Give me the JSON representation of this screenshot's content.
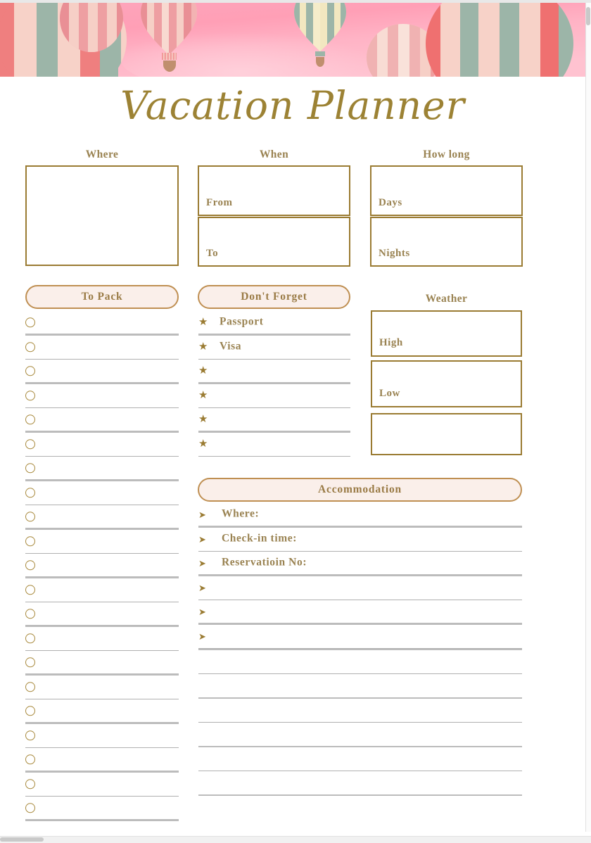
{
  "document": {
    "title": "Vacation Planner"
  },
  "colors": {
    "gold": "#9a7b32",
    "gold_text": "#9a8352",
    "title_gold": "#9c8234",
    "pill_fill": "#faefea",
    "pill_border": "#bf8f52",
    "rule": "#b4b4b4",
    "banner_pink": "#ffb4c6",
    "balloon_coral": "#f07e7e",
    "balloon_sage": "#9cb5a8",
    "balloon_pink": "#f5cfc6",
    "balloon_cream": "#f2e7c0",
    "basket_brown": "#c08f6e"
  },
  "banner": {
    "icon": "hot-air-balloons-banner",
    "balloon_count": 5
  },
  "sections": {
    "where": {
      "label": "Where",
      "box_value": ""
    },
    "when": {
      "label": "When",
      "fields": [
        {
          "label": "From",
          "value": ""
        },
        {
          "label": "To",
          "value": ""
        }
      ]
    },
    "how_long": {
      "label": "How long",
      "fields": [
        {
          "label": "Days",
          "value": ""
        },
        {
          "label": "Nights",
          "value": ""
        }
      ]
    },
    "to_pack": {
      "header": "To Pack",
      "bullet_icon": "circle-checkbox-icon",
      "items": [
        "",
        "",
        "",
        "",
        "",
        "",
        "",
        "",
        "",
        "",
        "",
        "",
        "",
        "",
        "",
        "",
        "",
        "",
        "",
        "",
        ""
      ]
    },
    "dont_forget": {
      "header": "Don't Forget",
      "bullet_icon": "star-icon",
      "items": [
        "Passport",
        "Visa",
        "",
        "",
        "",
        ""
      ]
    },
    "weather": {
      "label": "Weather",
      "fields": [
        {
          "label": "High",
          "value": ""
        },
        {
          "label": "Low",
          "value": ""
        },
        {
          "label": "",
          "value": ""
        }
      ]
    },
    "accommodation": {
      "header": "Accommodation",
      "bullet_icon": "arrow-flag-icon",
      "items": [
        "Where:",
        "Check-in time:",
        "Reservatioin No:",
        "",
        "",
        ""
      ]
    },
    "notes": {
      "lines": [
        "",
        "",
        "",
        "",
        "",
        "",
        ""
      ]
    }
  }
}
